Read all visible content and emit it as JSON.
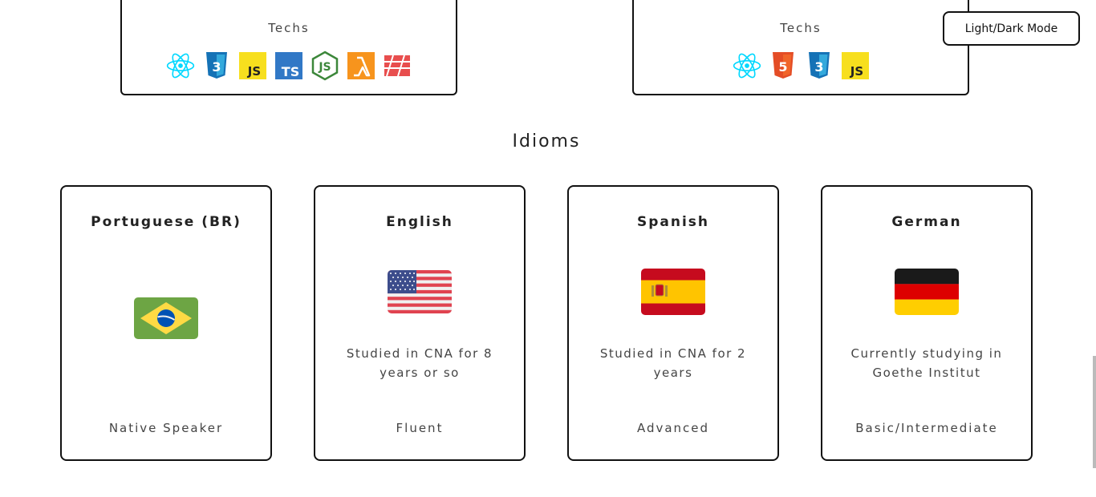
{
  "projects": [
    {
      "techs_label": "Techs",
      "techs": [
        "react-icon",
        "css3-icon",
        "javascript-icon",
        "typescript-icon",
        "nodejs-icon",
        "aws-lambda-icon",
        "flame-icon"
      ]
    },
    {
      "techs_label": "Techs",
      "techs": [
        "react-icon",
        "html5-icon",
        "css3-icon",
        "javascript-icon"
      ]
    }
  ],
  "mode_toggle": {
    "label": "Light/Dark Mode"
  },
  "idioms": {
    "title": "Idioms",
    "cards": [
      {
        "name": "Portuguese (BR)",
        "flag": "brazil-flag-icon",
        "description": "",
        "level": "Native Speaker"
      },
      {
        "name": "English",
        "flag": "usa-flag-icon",
        "description": "Studied in CNA for 8 years or so",
        "level": "Fluent"
      },
      {
        "name": "Spanish",
        "flag": "spain-flag-icon",
        "description": "Studied in CNA for 2 years",
        "level": "Advanced"
      },
      {
        "name": "German",
        "flag": "germany-flag-icon",
        "description": "Currently studying in Goethe Institut",
        "level": "Basic/Intermediate"
      }
    ]
  },
  "colors": {
    "border": "#111111",
    "text": "#222222",
    "muted_text": "#444444",
    "background": "#ffffff"
  }
}
